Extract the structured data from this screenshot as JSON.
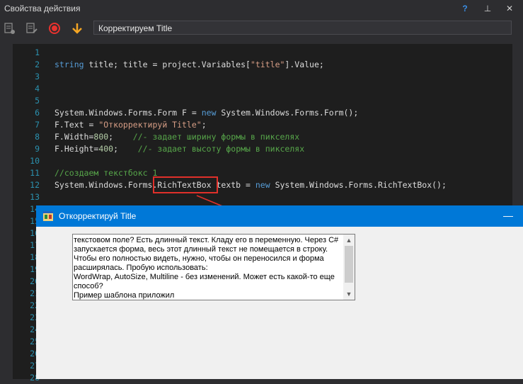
{
  "panel": {
    "title": "Свойства действия",
    "help_label": "?",
    "pin_label": "⊥",
    "close_label": "✕"
  },
  "toolbar": {
    "icons": [
      "properties-icon",
      "notes-icon",
      "record-icon",
      "down-arrow-icon"
    ],
    "title_value": "Корректируем Title"
  },
  "editor": {
    "lines": [
      {
        "n": "1",
        "code": ""
      },
      {
        "n": "2",
        "code": "string title; title = project.Variables[\"title\"].Value;"
      },
      {
        "n": "3",
        "code": ""
      },
      {
        "n": "4",
        "code": ""
      },
      {
        "n": "5",
        "code": ""
      },
      {
        "n": "6",
        "code": "System.Windows.Forms.Form F = new System.Windows.Forms.Form();"
      },
      {
        "n": "7",
        "code": "F.Text = \"Откорректируй Title\";"
      },
      {
        "n": "8",
        "code": "F.Width=800;    //- задает ширину формы в пикселях"
      },
      {
        "n": "9",
        "code": "F.Height=400;    //- задает высоту формы в пикселях"
      },
      {
        "n": "10",
        "code": ""
      },
      {
        "n": "11",
        "code": "//создаем текстбокс 1"
      },
      {
        "n": "12",
        "code": "System.Windows.Forms.RichTextBox textb = new System.Windows.Forms.RichTextBox();"
      },
      {
        "n": "13",
        "code": ""
      },
      {
        "n": "14",
        "code": ""
      },
      {
        "n": "15",
        "code": ""
      },
      {
        "n": "16",
        "code": ""
      },
      {
        "n": "17",
        "code": ""
      },
      {
        "n": "18",
        "code": ""
      },
      {
        "n": "19",
        "code": ""
      },
      {
        "n": "20",
        "code": ""
      },
      {
        "n": "21",
        "code": ""
      },
      {
        "n": "22",
        "code": ""
      },
      {
        "n": "23",
        "code": ""
      },
      {
        "n": "24",
        "code": ""
      },
      {
        "n": "25",
        "code": ""
      },
      {
        "n": "26",
        "code": ""
      },
      {
        "n": "27",
        "code": ""
      },
      {
        "n": "28",
        "code": ""
      }
    ]
  },
  "form": {
    "title": "Откорректируй Title",
    "minimize_label": "—",
    "richtext": "текстовом поле? Есть длинный текст. Кладу его в переменную. Через C# запускается форма, весь этот длинный текст не помещается в строку. Чтобы его полностью видеть, нужно, чтобы он переносился и форма расширялась. Пробую использовать:\nWordWrap, AutoSize, Multiline - без изменений. Может есть какой-то еще способ?\nПример шаблона приложил"
  },
  "colors": {
    "accent": "#0078d7",
    "highlight": "#e0302a",
    "record": "#e8322e",
    "arrow_icon": "#f5a623"
  }
}
